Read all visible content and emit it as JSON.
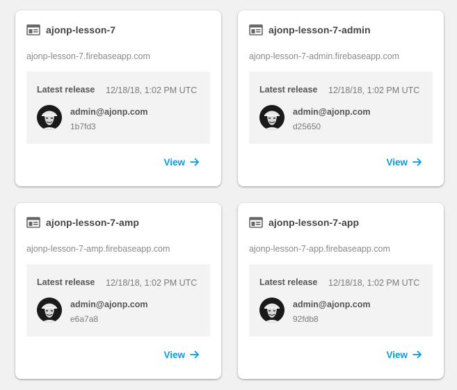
{
  "colors": {
    "accent": "#039be5",
    "card_bg": "#ffffff",
    "page_bg": "#f1f1f1",
    "release_bg": "#f3f3f3"
  },
  "icons": {
    "site": "web-site-icon",
    "view": "arrow-right-icon",
    "avatar": "user-avatar"
  },
  "sites": [
    {
      "name": "ajonp-lesson-7",
      "url": "ajonp-lesson-7.firebaseapp.com",
      "release_label": "Latest release",
      "release_date": "12/18/18, 1:02 PM UTC",
      "user": "admin@ajonp.com",
      "hash": "1b7fd3",
      "view_label": "View"
    },
    {
      "name": "ajonp-lesson-7-admin",
      "url": "ajonp-lesson-7-admin.firebaseapp.com",
      "release_label": "Latest release",
      "release_date": "12/18/18, 1:02 PM UTC",
      "user": "admin@ajonp.com",
      "hash": "d25650",
      "view_label": "View"
    },
    {
      "name": "ajonp-lesson-7-amp",
      "url": "ajonp-lesson-7-amp.firebaseapp.com",
      "release_label": "Latest release",
      "release_date": "12/18/18, 1:02 PM UTC",
      "user": "admin@ajonp.com",
      "hash": "e6a7a8",
      "view_label": "View"
    },
    {
      "name": "ajonp-lesson-7-app",
      "url": "ajonp-lesson-7-app.firebaseapp.com",
      "release_label": "Latest release",
      "release_date": "12/18/18, 1:02 PM UTC",
      "user": "admin@ajonp.com",
      "hash": "92fdb8",
      "view_label": "View"
    }
  ]
}
